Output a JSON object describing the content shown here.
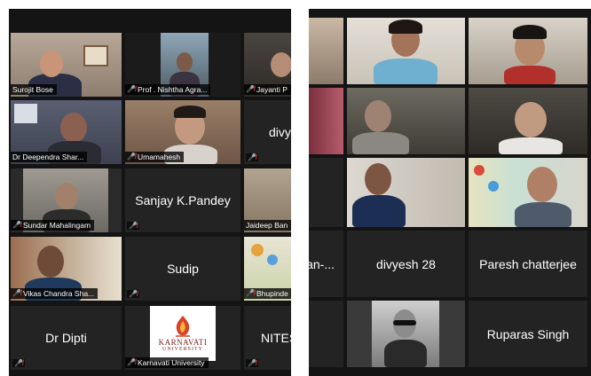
{
  "left_gallery": {
    "tiles": {
      "surojit": {
        "name": "Surojit Bose"
      },
      "nishtha": {
        "name": "Prof . Nishtha Agra..."
      },
      "jayanti": {
        "name": "Jayanti P"
      },
      "deependra": {
        "name": "Dr Deependra Shar..."
      },
      "umamahesh": {
        "name": "Umamahesh"
      },
      "divy": {
        "name": "divy"
      },
      "sundar": {
        "name": "Sundar Mahalingam"
      },
      "sanjay": {
        "name": "Sanjay K.Pandey"
      },
      "jaideep": {
        "name": "Jaideep Ban"
      },
      "vikas": {
        "name": "Vikas Chandra Sha..."
      },
      "sudip": {
        "name": "Sudip"
      },
      "bhupinder": {
        "name": "Bhupinde"
      },
      "dipti": {
        "name": "Dr Dipti"
      },
      "karnavati": {
        "name": "Karnavati University",
        "logo_line1": "KARNAVATI",
        "logo_line2": "UNIVERSITY"
      },
      "nitesh": {
        "name": "NITES"
      }
    }
  },
  "right_gallery": {
    "tiles": {
      "an": {
        "name": "an-..."
      },
      "divyesh": {
        "name": "divyesh 28"
      },
      "paresh": {
        "name": "Paresh chatterjee"
      },
      "ruparas": {
        "name": "Ruparas Singh"
      }
    }
  },
  "icons": {
    "mute": "muted-mic-icon"
  },
  "colors": {
    "active_speaker_border": "#c8d24a",
    "mute_red": "#e53935"
  }
}
